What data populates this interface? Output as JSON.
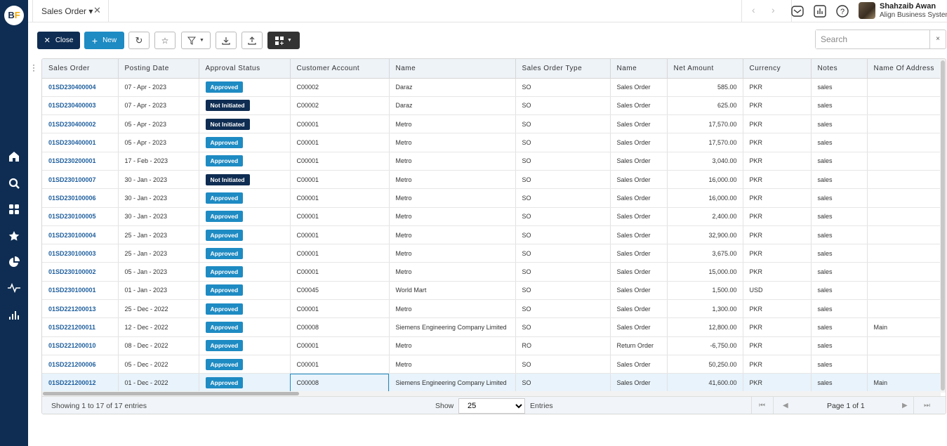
{
  "brand": {
    "logo_left": "B",
    "logo_right": "F"
  },
  "tab": {
    "label": "Sales Order ▾",
    "close": "✕"
  },
  "nav": {
    "prev": "‹",
    "next": "›"
  },
  "user": {
    "name": "Shahzaib Awan",
    "org": "Align Business System"
  },
  "toolbar": {
    "close_label": "Close",
    "new_label": "New"
  },
  "search": {
    "placeholder": "Search",
    "clear": "×"
  },
  "columns": [
    "Sales Order",
    "Posting Date",
    "Approval Status",
    "Customer Account",
    "Name",
    "Sales Order Type",
    "Name",
    "Net Amount",
    "Currency",
    "Notes",
    "Name Of Address"
  ],
  "rows": [
    [
      "01SD230400004",
      "07 - Apr - 2023",
      "Approved",
      "C00002",
      "Daraz",
      "SO",
      "Sales Order",
      "585.00",
      "PKR",
      "sales",
      ""
    ],
    [
      "01SD230400003",
      "07 - Apr - 2023",
      "Not Initiated",
      "C00002",
      "Daraz",
      "SO",
      "Sales Order",
      "625.00",
      "PKR",
      "sales",
      ""
    ],
    [
      "01SD230400002",
      "05 - Apr - 2023",
      "Not Initiated",
      "C00001",
      "Metro",
      "SO",
      "Sales Order",
      "17,570.00",
      "PKR",
      "sales",
      ""
    ],
    [
      "01SD230400001",
      "05 - Apr - 2023",
      "Approved",
      "C00001",
      "Metro",
      "SO",
      "Sales Order",
      "17,570.00",
      "PKR",
      "sales",
      ""
    ],
    [
      "01SD230200001",
      "17 - Feb - 2023",
      "Approved",
      "C00001",
      "Metro",
      "SO",
      "Sales Order",
      "3,040.00",
      "PKR",
      "sales",
      ""
    ],
    [
      "01SD230100007",
      "30 - Jan - 2023",
      "Not Initiated",
      "C00001",
      "Metro",
      "SO",
      "Sales Order",
      "16,000.00",
      "PKR",
      "sales",
      ""
    ],
    [
      "01SD230100006",
      "30 - Jan - 2023",
      "Approved",
      "C00001",
      "Metro",
      "SO",
      "Sales Order",
      "16,000.00",
      "PKR",
      "sales",
      ""
    ],
    [
      "01SD230100005",
      "30 - Jan - 2023",
      "Approved",
      "C00001",
      "Metro",
      "SO",
      "Sales Order",
      "2,400.00",
      "PKR",
      "sales",
      ""
    ],
    [
      "01SD230100004",
      "25 - Jan - 2023",
      "Approved",
      "C00001",
      "Metro",
      "SO",
      "Sales Order",
      "32,900.00",
      "PKR",
      "sales",
      ""
    ],
    [
      "01SD230100003",
      "25 - Jan - 2023",
      "Approved",
      "C00001",
      "Metro",
      "SO",
      "Sales Order",
      "3,675.00",
      "PKR",
      "sales",
      ""
    ],
    [
      "01SD230100002",
      "05 - Jan - 2023",
      "Approved",
      "C00001",
      "Metro",
      "SO",
      "Sales Order",
      "15,000.00",
      "PKR",
      "sales",
      ""
    ],
    [
      "01SD230100001",
      "01 - Jan - 2023",
      "Approved",
      "C00045",
      "World Mart",
      "SO",
      "Sales Order",
      "1,500.00",
      "USD",
      "sales",
      ""
    ],
    [
      "01SD221200013",
      "25 - Dec - 2022",
      "Approved",
      "C00001",
      "Metro",
      "SO",
      "Sales Order",
      "1,300.00",
      "PKR",
      "sales",
      ""
    ],
    [
      "01SD221200011",
      "12 - Dec - 2022",
      "Approved",
      "C00008",
      "Siemens Engineering Company Limited",
      "SO",
      "Sales Order",
      "12,800.00",
      "PKR",
      "sales",
      "Main"
    ],
    [
      "01SD221200010",
      "08 - Dec - 2022",
      "Approved",
      "C00001",
      "Metro",
      "RO",
      "Return Order",
      "-6,750.00",
      "PKR",
      "sales",
      ""
    ],
    [
      "01SD221200006",
      "05 - Dec - 2022",
      "Approved",
      "C00001",
      "Metro",
      "SO",
      "Sales Order",
      "50,250.00",
      "PKR",
      "sales",
      ""
    ],
    [
      "01SD221200012",
      "01 - Dec - 2022",
      "Approved",
      "C00008",
      "Siemens Engineering Company Limited",
      "SO",
      "Sales Order",
      "41,600.00",
      "PKR",
      "sales",
      "Main"
    ]
  ],
  "footer": {
    "info": "Showing 1 to 17 of 17 entries",
    "show": "Show",
    "page_size": "25",
    "entries": "Entries",
    "page": "Page 1 of 1"
  },
  "colors": {
    "sidebar": "#0f2d52",
    "approved": "#1e8bc3",
    "not_initiated": "#0f2d52",
    "link": "#1f5f9e"
  }
}
